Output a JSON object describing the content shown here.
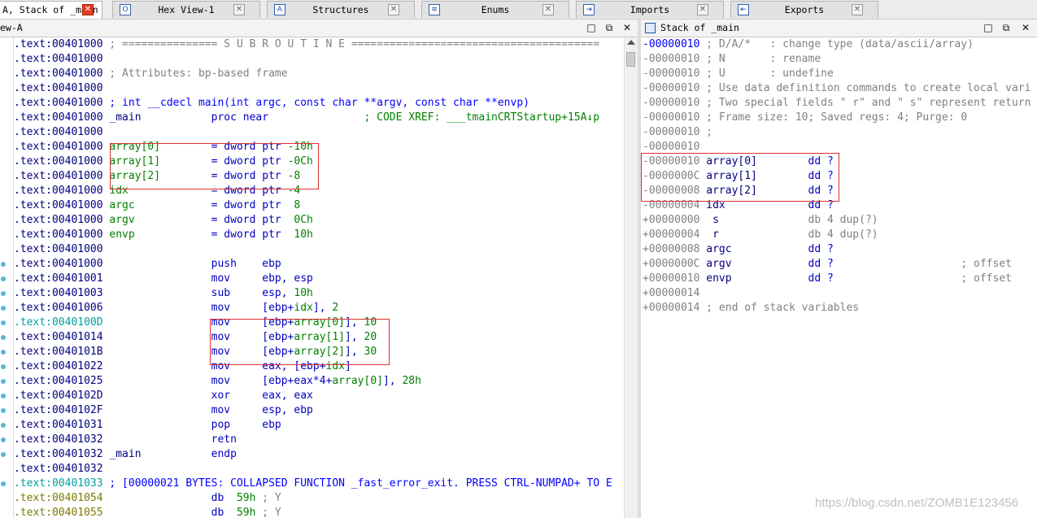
{
  "tabs": [
    {
      "label": "A, Stack of _main",
      "icon": "view-icon",
      "active": true
    },
    {
      "label": "Hex View-1",
      "icon": "hex-view-icon",
      "active": false
    },
    {
      "label": "Structures",
      "icon": "structures-icon",
      "active": false
    },
    {
      "label": "Enums",
      "icon": "enums-icon",
      "active": false
    },
    {
      "label": "Imports",
      "icon": "imports-icon",
      "active": false
    },
    {
      "label": "Exports",
      "icon": "exports-icon",
      "active": false
    }
  ],
  "tab_icon_glyphs": [
    "",
    "O",
    "A",
    "≡",
    "⇥",
    "⇤"
  ],
  "left_panel": {
    "title": "ew-A",
    "lines": [
      [
        [
          "seg",
          ".text:00401000 "
        ],
        [
          "cmt",
          "; =============== S U B R O U T I N E ======================================="
        ]
      ],
      [
        [
          "seg",
          ".text:00401000"
        ]
      ],
      [
        [
          "seg",
          ".text:00401000 "
        ],
        [
          "cmt",
          "; Attributes: bp-based frame"
        ]
      ],
      [
        [
          "seg",
          ".text:00401000"
        ]
      ],
      [
        [
          "seg",
          ".text:00401000 "
        ],
        [
          "blue",
          "; int __cdecl main(int argc, const char **argv, const char **envp)"
        ]
      ],
      [
        [
          "seg",
          ".text:00401000 "
        ],
        [
          "navy",
          "_main           "
        ],
        [
          "kw",
          "proc near"
        ],
        [
          "grn",
          "               ; CODE XREF: ___tmainCRTStartup+15A↓p"
        ]
      ],
      [
        [
          "seg",
          ".text:00401000"
        ]
      ],
      [
        [
          "seg",
          ".text:00401000 "
        ],
        [
          "grn",
          "array[0]"
        ],
        [
          "kw",
          "        = dword ptr "
        ],
        [
          "num",
          "-10h"
        ]
      ],
      [
        [
          "seg",
          ".text:00401000 "
        ],
        [
          "grn",
          "array[1]"
        ],
        [
          "kw",
          "        = dword ptr "
        ],
        [
          "num",
          "-0Ch"
        ]
      ],
      [
        [
          "seg",
          ".text:00401000 "
        ],
        [
          "grn",
          "array[2]"
        ],
        [
          "kw",
          "        = dword ptr "
        ],
        [
          "num",
          "-8"
        ]
      ],
      [
        [
          "seg",
          ".text:00401000 "
        ],
        [
          "grn",
          "idx"
        ],
        [
          "kw",
          "             = dword ptr "
        ],
        [
          "num",
          "-4"
        ]
      ],
      [
        [
          "seg",
          ".text:00401000 "
        ],
        [
          "grn",
          "argc"
        ],
        [
          "kw",
          "            = dword ptr  "
        ],
        [
          "num",
          "8"
        ]
      ],
      [
        [
          "seg",
          ".text:00401000 "
        ],
        [
          "grn",
          "argv"
        ],
        [
          "kw",
          "            = dword ptr  "
        ],
        [
          "num",
          "0Ch"
        ]
      ],
      [
        [
          "seg",
          ".text:00401000 "
        ],
        [
          "grn",
          "envp"
        ],
        [
          "kw",
          "            = dword ptr  "
        ],
        [
          "num",
          "10h"
        ]
      ],
      [
        [
          "seg",
          ".text:00401000"
        ]
      ],
      [
        [
          "seg",
          ".text:00401000                 "
        ],
        [
          "kw",
          "push    ebp"
        ]
      ],
      [
        [
          "seg",
          ".text:00401001                 "
        ],
        [
          "kw",
          "mov     ebp, esp"
        ]
      ],
      [
        [
          "seg",
          ".text:00401003                 "
        ],
        [
          "kw",
          "sub     esp, "
        ],
        [
          "num",
          "10h"
        ]
      ],
      [
        [
          "seg",
          ".text:00401006                 "
        ],
        [
          "kw",
          "mov     [ebp+"
        ],
        [
          "grn",
          "idx"
        ],
        [
          "kw",
          "], "
        ],
        [
          "num",
          "2"
        ]
      ],
      [
        [
          "seg-b",
          ".text:0040100D                 "
        ],
        [
          "kw",
          "mov     [ebp+"
        ],
        [
          "grn",
          "array[0]"
        ],
        [
          "kw",
          "], "
        ],
        [
          "num",
          "10"
        ]
      ],
      [
        [
          "seg",
          ".text:00401014                 "
        ],
        [
          "kw",
          "mov     [ebp+"
        ],
        [
          "grn",
          "array[1]"
        ],
        [
          "kw",
          "], "
        ],
        [
          "num",
          "20"
        ]
      ],
      [
        [
          "seg",
          ".text:0040101B                 "
        ],
        [
          "kw",
          "mov     [ebp+"
        ],
        [
          "grn",
          "array[2]"
        ],
        [
          "kw",
          "], "
        ],
        [
          "num",
          "30"
        ]
      ],
      [
        [
          "seg",
          ".text:00401022                 "
        ],
        [
          "kw",
          "mov     eax, [ebp+"
        ],
        [
          "grn",
          "idx"
        ],
        [
          "kw",
          "]"
        ]
      ],
      [
        [
          "seg",
          ".text:00401025                 "
        ],
        [
          "kw",
          "mov     [ebp+eax*4+"
        ],
        [
          "grn",
          "array[0]"
        ],
        [
          "kw",
          "], "
        ],
        [
          "num",
          "28h"
        ]
      ],
      [
        [
          "seg",
          ".text:0040102D                 "
        ],
        [
          "kw",
          "xor     eax, eax"
        ]
      ],
      [
        [
          "seg",
          ".text:0040102F                 "
        ],
        [
          "kw",
          "mov     esp, ebp"
        ]
      ],
      [
        [
          "seg",
          ".text:00401031                 "
        ],
        [
          "kw",
          "pop     ebp"
        ]
      ],
      [
        [
          "seg",
          ".text:00401032                 "
        ],
        [
          "kw",
          "retn"
        ]
      ],
      [
        [
          "seg",
          ".text:00401032 "
        ],
        [
          "navy",
          "_main           "
        ],
        [
          "kw",
          "endp"
        ]
      ],
      [
        [
          "seg",
          ".text:00401032"
        ]
      ],
      [
        [
          "seg-b",
          ".text:00401033 "
        ],
        [
          "blue",
          "; [00000021 BYTES: COLLAPSED FUNCTION _fast_error_exit. PRESS CTRL-NUMPAD+ TO E"
        ]
      ],
      [
        [
          "yel",
          ".text:00401054                 "
        ],
        [
          "kw",
          "db  "
        ],
        [
          "num",
          "59h"
        ],
        [
          "cmt",
          " ; Y"
        ]
      ],
      [
        [
          "yel",
          ".text:00401055                 "
        ],
        [
          "kw",
          "db  "
        ],
        [
          "num",
          "59h"
        ],
        [
          "cmt",
          " ; Y"
        ]
      ]
    ]
  },
  "right_panel": {
    "title": "Stack of _main",
    "lines": [
      [
        [
          "blue",
          "-00000010 "
        ],
        [
          "cmt",
          "; D/A/*   : change type (data/ascii/array)"
        ]
      ],
      [
        [
          "cmt",
          "-00000010 ; N       : rename"
        ]
      ],
      [
        [
          "cmt",
          "-00000010 ; U       : undefine"
        ]
      ],
      [
        [
          "cmt",
          "-00000010 ; Use data definition commands to create local vari"
        ]
      ],
      [
        [
          "cmt",
          "-00000010 ; Two special fields \" r\" and \" s\" represent return"
        ]
      ],
      [
        [
          "cmt",
          "-00000010 ; Frame size: 10; Saved regs: 4; Purge: 0"
        ]
      ],
      [
        [
          "cmt",
          "-00000010 ;"
        ]
      ],
      [
        [
          "cmt",
          "-00000010"
        ]
      ],
      [
        [
          "cmt",
          "-00000010 "
        ],
        [
          "navy",
          "array[0]"
        ],
        [
          "kw",
          "        dd ?"
        ]
      ],
      [
        [
          "cmt",
          "-0000000C "
        ],
        [
          "navy",
          "array[1]"
        ],
        [
          "kw",
          "        dd ?"
        ]
      ],
      [
        [
          "cmt",
          "-00000008 "
        ],
        [
          "navy",
          "array[2]"
        ],
        [
          "kw",
          "        dd ?"
        ]
      ],
      [
        [
          "cmt",
          "-00000004 "
        ],
        [
          "navy",
          "idx"
        ],
        [
          "kw",
          "             dd ?"
        ]
      ],
      [
        [
          "cmt",
          "+00000000 "
        ],
        [
          "navy",
          " s"
        ],
        [
          "cmt",
          "              db 4 dup(?)"
        ]
      ],
      [
        [
          "cmt",
          "+00000004 "
        ],
        [
          "navy",
          " r"
        ],
        [
          "cmt",
          "              db 4 dup(?)"
        ]
      ],
      [
        [
          "cmt",
          "+00000008 "
        ],
        [
          "navy",
          "argc"
        ],
        [
          "kw",
          "            dd ?"
        ]
      ],
      [
        [
          "cmt",
          "+0000000C "
        ],
        [
          "navy",
          "argv"
        ],
        [
          "kw",
          "            dd ?"
        ],
        [
          "cmt",
          "                    ; offset"
        ]
      ],
      [
        [
          "cmt",
          "+00000010 "
        ],
        [
          "navy",
          "envp"
        ],
        [
          "kw",
          "            dd ?"
        ],
        [
          "cmt",
          "                    ; offset"
        ]
      ],
      [
        [
          "cmt",
          "+00000014"
        ]
      ],
      [
        [
          "cmt",
          "+00000014 ; end of stack variables"
        ]
      ]
    ]
  },
  "watermark": "https://blog.csdn.net/ZOMB1E123456",
  "colors": {
    "segment": "#000080",
    "comment": "#808080",
    "variable": "#008000",
    "instruction": "#0000c0",
    "highlight_box": "#e03030"
  }
}
